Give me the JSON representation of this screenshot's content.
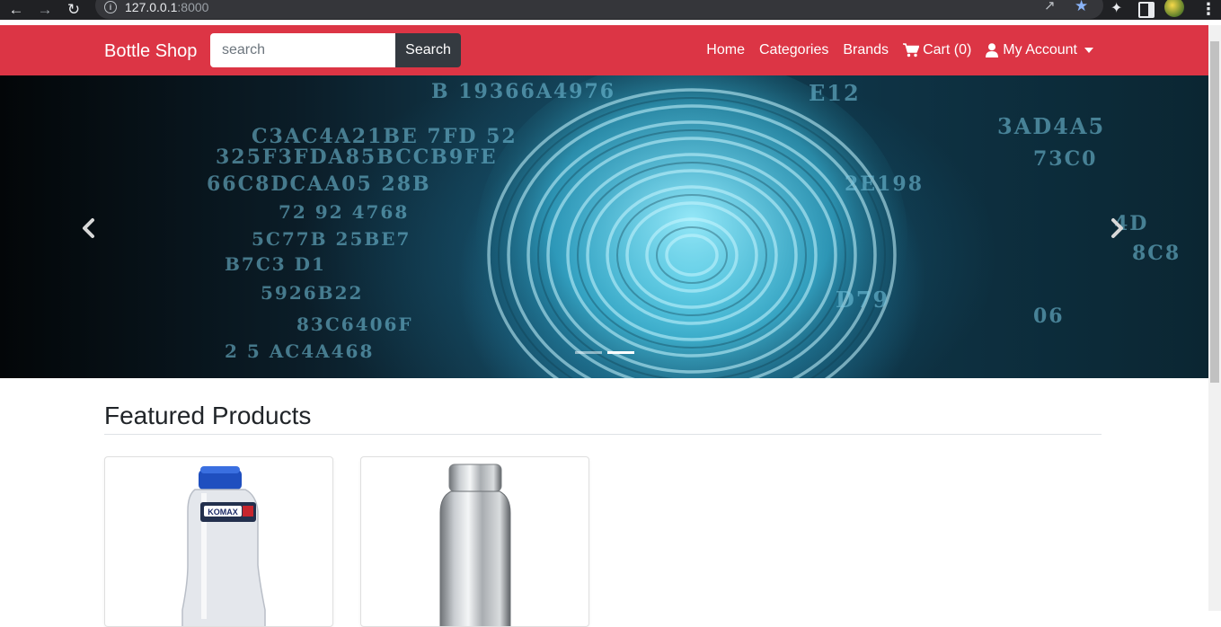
{
  "browser": {
    "url_host": "127.0.0.1",
    "url_port": ":8000",
    "icons": [
      "back-icon",
      "forward-icon",
      "reload-icon",
      "info-icon",
      "share-icon",
      "star-icon",
      "extensions-icon",
      "side-panel-icon",
      "avatar",
      "menu-icon"
    ]
  },
  "navbar": {
    "brand": "Bottle Shop",
    "search_placeholder": "search",
    "search_button": "Search",
    "links": {
      "home": "Home",
      "categories": "Categories",
      "brands": "Brands",
      "cart": "Cart (0)",
      "account": "My Account"
    },
    "color": "#dc3545"
  },
  "carousel": {
    "slide_count": 2,
    "active_index": 1,
    "hex_lines": [
      "B 19366A4976",
      "C3AC4A21BE 7FD 52",
      "325F3FDA85BCCB9FE",
      "66C8DCAA05 28B",
      "72 92 4768",
      "5C77B 25BE7",
      "B7C3 D1",
      "5926B22",
      "83C6406F",
      "2 5 AC4A468",
      "E12",
      "3AD4A5",
      "73C0",
      "2E198",
      "4D",
      "8C8",
      "D79",
      "06"
    ]
  },
  "main": {
    "section_title": "Featured Products",
    "products": [
      {
        "image_label": "KOMAX",
        "kind": "plastic-bottle"
      },
      {
        "image_label": "",
        "kind": "steel-bottle"
      }
    ]
  }
}
